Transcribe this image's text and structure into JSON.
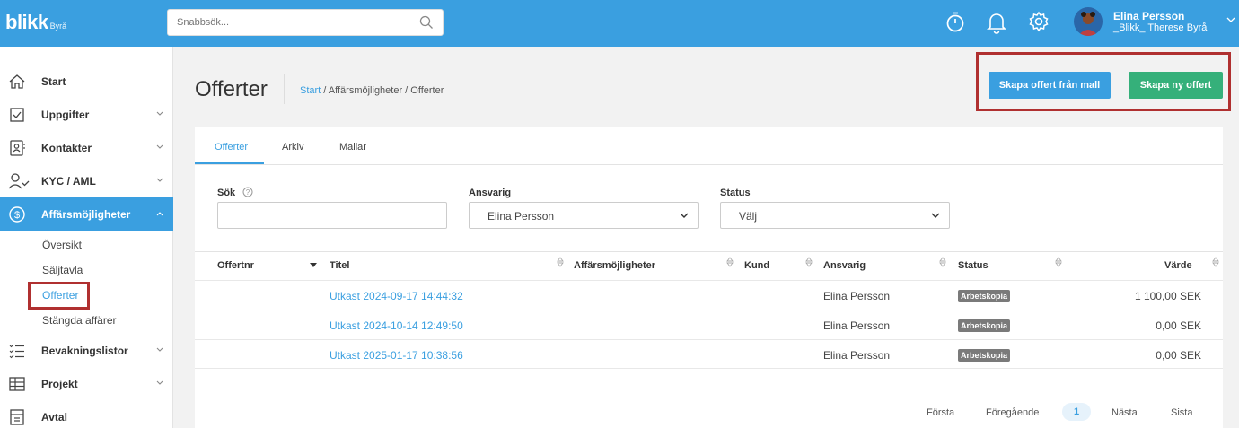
{
  "app": {
    "logo_text": "blikk",
    "logo_sub": "Byrå"
  },
  "topbar": {
    "search_placeholder": "Snabbsök...",
    "user_name": "Elina Persson",
    "user_company": "_Blikk_ Therese Byrå"
  },
  "sidebar": {
    "items": [
      {
        "label": "Start",
        "icon": "home-icon"
      },
      {
        "label": "Uppgifter",
        "icon": "checkbox-icon"
      },
      {
        "label": "Kontakter",
        "icon": "contact-card-icon"
      },
      {
        "label": "KYC / AML",
        "icon": "user-check-icon"
      },
      {
        "label": "Affärsmöjligheter",
        "icon": "dollar-circle-icon"
      },
      {
        "label": "Bevakningslistor",
        "icon": "checklist-icon"
      },
      {
        "label": "Projekt",
        "icon": "table-icon"
      },
      {
        "label": "Avtal",
        "icon": "contract-icon"
      }
    ],
    "subitems": [
      "Översikt",
      "Säljtavla",
      "Offerter",
      "Stängda affärer"
    ]
  },
  "header": {
    "title": "Offerter",
    "breadcrumb_link": "Start",
    "breadcrumb_rest": " / Affärsmöjligheter / Offerter",
    "btn_from_template": "Skapa offert från mall",
    "btn_new": "Skapa ny offert"
  },
  "tabs": [
    "Offerter",
    "Arkiv",
    "Mallar"
  ],
  "filters": {
    "search_label": "Sök",
    "responsible_label": "Ansvarig",
    "responsible_value": "Elina Persson",
    "status_label": "Status",
    "status_value": "Välj"
  },
  "table": {
    "columns": [
      "Offertnr",
      "Titel",
      "Affärsmöjligheter",
      "Kund",
      "Ansvarig",
      "Status",
      "Värde"
    ],
    "rows": [
      {
        "title": "Utkast 2024-09-17 14:44:32",
        "responsible": "Elina Persson",
        "status": "Arbetskopia",
        "value": "1 100,00 SEK"
      },
      {
        "title": "Utkast 2024-10-14 12:49:50",
        "responsible": "Elina Persson",
        "status": "Arbetskopia",
        "value": "0,00 SEK"
      },
      {
        "title": "Utkast 2025-01-17 10:38:56",
        "responsible": "Elina Persson",
        "status": "Arbetskopia",
        "value": "0,00 SEK"
      }
    ]
  },
  "pagination": {
    "first": "Första",
    "prev": "Föregående",
    "current": "1",
    "next": "Nästa",
    "last": "Sista"
  },
  "colors": {
    "primary": "#3a9fe0",
    "success": "#35b07a",
    "highlight": "#b03030"
  }
}
